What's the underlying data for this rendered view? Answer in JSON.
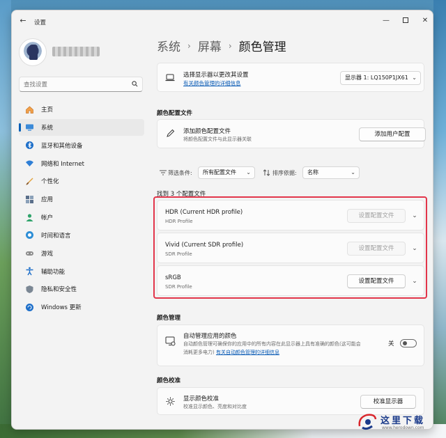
{
  "window": {
    "app_title": "设置",
    "back_glyph": "←",
    "minimize_glyph": "—",
    "close_glyph": "✕"
  },
  "sidebar": {
    "search_placeholder": "查找设置",
    "items": [
      {
        "label": "主页",
        "icon": "home-icon",
        "active": false
      },
      {
        "label": "系统",
        "icon": "system-icon",
        "active": true
      },
      {
        "label": "蓝牙和其他设备",
        "icon": "bluetooth-icon",
        "active": false
      },
      {
        "label": "网络和 Internet",
        "icon": "wifi-icon",
        "active": false
      },
      {
        "label": "个性化",
        "icon": "brush-icon",
        "active": false
      },
      {
        "label": "应用",
        "icon": "apps-icon",
        "active": false
      },
      {
        "label": "帐户",
        "icon": "account-icon",
        "active": false
      },
      {
        "label": "时间和语言",
        "icon": "globe-icon",
        "active": false
      },
      {
        "label": "游戏",
        "icon": "gamepad-icon",
        "active": false
      },
      {
        "label": "辅助功能",
        "icon": "accessibility-icon",
        "active": false
      },
      {
        "label": "隐私和安全性",
        "icon": "shield-icon",
        "active": false
      },
      {
        "label": "Windows 更新",
        "icon": "update-icon",
        "active": false
      }
    ]
  },
  "breadcrumb": {
    "part1": "系统",
    "part2": "屏幕",
    "part3": "颜色管理",
    "sep": "›"
  },
  "display_select": {
    "title": "选择显示器以更改其设置",
    "link": "有关颜色管理的详细信息",
    "value": "显示器 1: LQ150P1JX61"
  },
  "color_profiles": {
    "section_title": "颜色配置文件",
    "add_title": "添加颜色配置文件",
    "add_sub": "将颜色配置文件与此显示器关联",
    "add_button": "添加用户配置"
  },
  "filter": {
    "filter_label": "筛选条件:",
    "filter_value": "所有配置文件",
    "sort_label": "排序依据:",
    "sort_value": "名称",
    "found_text": "找到 3 个配置文件"
  },
  "profiles": [
    {
      "name": "HDR (Current HDR profile)",
      "type": "HDR Profile",
      "button": "设置配置文件",
      "disabled": true
    },
    {
      "name": "Vivid (Current SDR profile)",
      "type": "SDR Profile",
      "button": "设置配置文件",
      "disabled": true
    },
    {
      "name": "sRGB",
      "type": "SDR Profile",
      "button": "设置配置文件",
      "disabled": false
    }
  ],
  "color_management": {
    "section_title": "颜色管理",
    "auto_title": "自动管理应用的颜色",
    "auto_desc_1": "自动颜色管理可确保你的应用中的所有内容在此显示器上具有准确的颜色(这可能会",
    "auto_desc_2": "消耗更多电力)",
    "auto_link": "有关自动颜色管理的详细信息",
    "toggle_label": "关"
  },
  "calibration": {
    "section_title": "颜色校准",
    "title": "显示颜色校准",
    "sub": "校准显示颜色、亮度和对比度",
    "button": "校准显示器"
  },
  "watermark": {
    "brand": "这里下载",
    "url": "www.herodown.com"
  },
  "colors": {
    "accent": "#005fb8",
    "highlight": "#e2354a",
    "link": "#0a5bb5"
  }
}
